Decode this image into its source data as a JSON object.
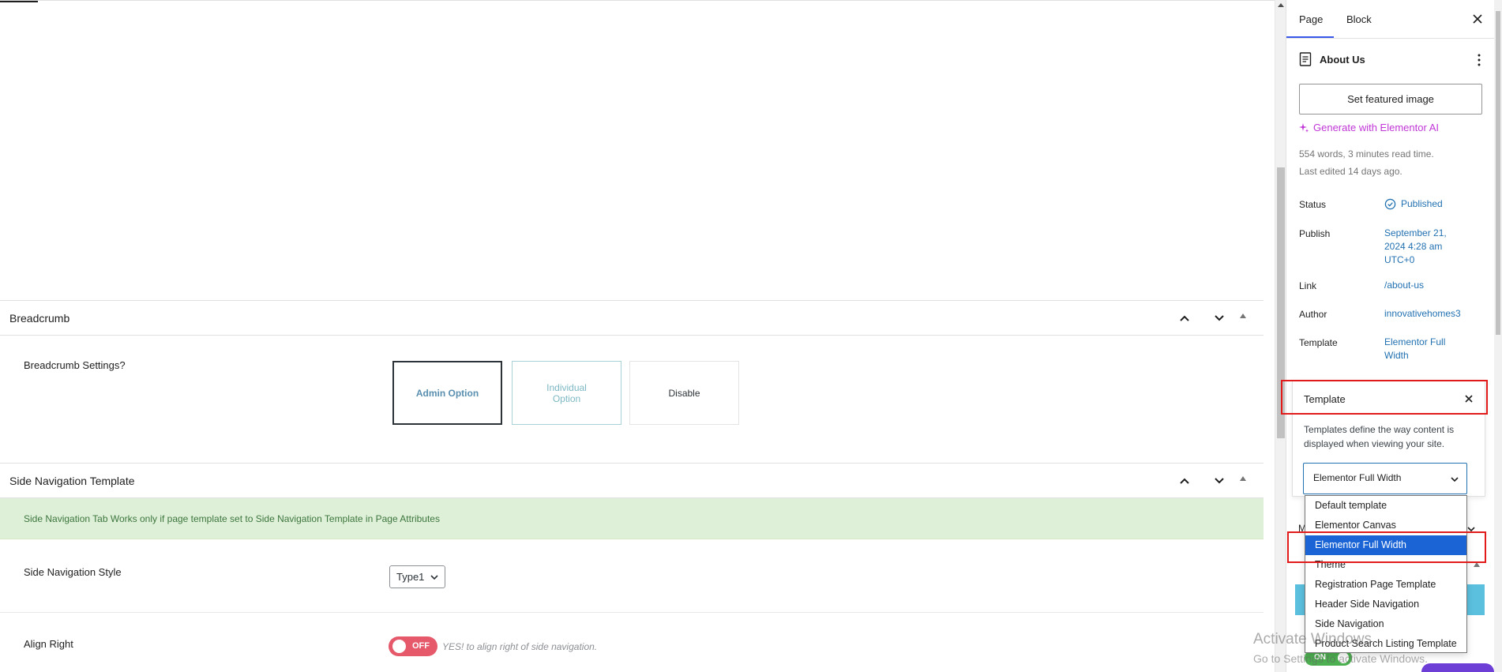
{
  "breadcrumb": {
    "title": "Breadcrumb",
    "settings_label": "Breadcrumb Settings?",
    "options": [
      "Admin Option",
      "Individual Option",
      "Disable"
    ]
  },
  "side_navigation": {
    "title": "Side Navigation Template",
    "notice": "Side Navigation Tab Works only if page template set to Side Navigation Template in Page Attributes",
    "style_label": "Side Navigation Style",
    "style_value": "Type1",
    "align_right_label": "Align Right",
    "align_toggle": "OFF",
    "align_hint": "YES! to align right of side navigation."
  },
  "sidebar": {
    "tabs": [
      "Page",
      "Block"
    ],
    "post_title": "About Us",
    "featured_image_button": "Set featured image",
    "elementor_ai": "Generate with Elementor AI",
    "word_count": "554 words, 3 minutes read time.",
    "last_edited": "Last edited 14 days ago.",
    "meta": {
      "status_label": "Status",
      "status_value": "Published",
      "publish_label": "Publish",
      "publish_value": "September 21, 2024 4:28 am UTC+0",
      "link_label": "Link",
      "link_value": "/about-us",
      "author_label": "Author",
      "author_value": "innovativehomes3",
      "template_label": "Template",
      "template_value": "Elementor Full Width"
    }
  },
  "template_popover": {
    "title": "Template",
    "description": "Templates define the way content is displayed when viewing your site.",
    "selected": "Elementor Full Width",
    "options": [
      "Default template",
      "Elementor Canvas",
      "Elementor Full Width",
      "Theme",
      "Registration Page Template",
      "Header Side Navigation",
      "Side Navigation",
      "Product Search Listing Template"
    ],
    "selected_index": 2
  },
  "background": {
    "hidden_label": "M",
    "bottom_toggle": "ON"
  },
  "watermark": {
    "title": "Activate Windows",
    "subtitle": "Go to Settings to activate Windows."
  },
  "colors": {
    "accent": "#2271b1",
    "highlight": "#e11a1a",
    "selected_option": "#1a64d6",
    "ai": "#c036d6",
    "notice_bg": "#dff0d8",
    "toggle_off": "#e5596b"
  }
}
